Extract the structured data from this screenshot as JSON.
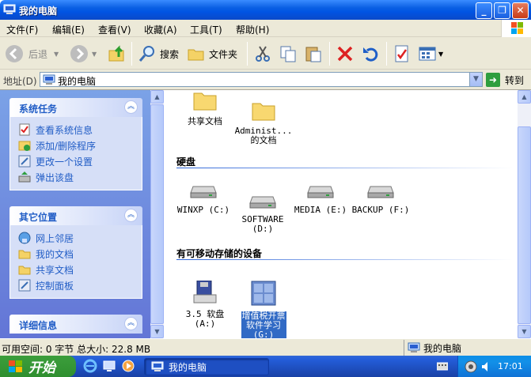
{
  "window": {
    "title": "我的电脑"
  },
  "menu": [
    "文件(F)",
    "编辑(E)",
    "查看(V)",
    "收藏(A)",
    "工具(T)",
    "帮助(H)"
  ],
  "toolbar": {
    "back": "后退",
    "search": "搜索",
    "folders": "文件夹"
  },
  "address": {
    "label": "地址(D)",
    "value": "我的电脑",
    "go": "转到"
  },
  "left_panels": [
    {
      "title": "系统任务",
      "links": [
        "查看系统信息",
        "添加/删除程序",
        "更改一个设置",
        "弹出该盘"
      ]
    },
    {
      "title": "其它位置",
      "links": [
        "网上邻居",
        "我的文档",
        "共享文档",
        "控制面板"
      ]
    },
    {
      "title": "详细信息",
      "links": []
    }
  ],
  "folders": [
    {
      "label": "共享文档"
    },
    {
      "label": "Administ...\n的文档"
    }
  ],
  "sections": {
    "disks": "硬盘",
    "removable": "有可移动存储的设备"
  },
  "drives": [
    {
      "label": "WINXP (C:)"
    },
    {
      "label": "SOFTWARE\n(D:)"
    },
    {
      "label": "MEDIA (E:)"
    },
    {
      "label": "BACKUP (F:)"
    }
  ],
  "removable": [
    {
      "label": "3.5 软盘\n(A:)"
    },
    {
      "label": "增值税开票\n软件学习\n(G:)",
      "selected": true
    }
  ],
  "status": {
    "left": "可用空间: 0 字节 总大小: 22.8 MB",
    "right": "我的电脑"
  },
  "taskbar": {
    "start": "开始",
    "task": "我的电脑",
    "clock": "17:01"
  },
  "colors": {
    "titlebar": "#0054e3",
    "taskpane": "#6375d6",
    "link": "#215dc6",
    "selection": "#316ac5"
  }
}
